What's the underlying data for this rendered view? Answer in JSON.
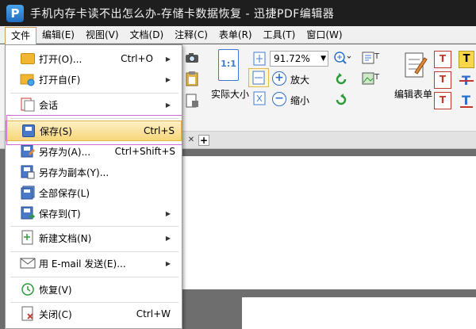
{
  "window": {
    "title": "手机内存卡读不出怎么办-存储卡数据恢复 - 迅捷PDF编辑器",
    "logo_letter": "P"
  },
  "menubar": {
    "items": [
      "文件",
      "编辑(E)",
      "视图(V)",
      "文档(D)",
      "注释(C)",
      "表单(R)",
      "工具(T)",
      "窗口(W)"
    ],
    "active_index": 0
  },
  "toolbar": {
    "actual_size_label": "实际大小",
    "fit_icon_text": "1:1",
    "zoom_value": "91.72%",
    "zoom_in_label": "放大",
    "zoom_out_label": "缩小",
    "edit_form_label": "编辑表单"
  },
  "file_menu": {
    "items": [
      {
        "label": "打开(O)...",
        "shortcut": "Ctrl+O",
        "icon": "folder-open-icon",
        "submenu": false
      },
      {
        "label": "打开自(F)",
        "shortcut": "",
        "icon": "folder-globe-icon",
        "submenu": true
      },
      {
        "label": "会话",
        "shortcut": "",
        "icon": "session-icon",
        "submenu": true
      },
      {
        "label": "保存(S)",
        "shortcut": "Ctrl+S",
        "icon": "save-icon",
        "submenu": false,
        "highlighted": true
      },
      {
        "label": "另存为(A)...",
        "shortcut": "Ctrl+Shift+S",
        "icon": "save-as-icon",
        "submenu": false
      },
      {
        "label": "另存为副本(Y)...",
        "shortcut": "",
        "icon": "save-copy-icon",
        "submenu": false
      },
      {
        "label": "全部保存(L)",
        "shortcut": "",
        "icon": "save-all-icon",
        "submenu": false
      },
      {
        "label": "保存到(T)",
        "shortcut": "",
        "icon": "save-to-icon",
        "submenu": true
      },
      {
        "label": "新建文档(N)",
        "shortcut": "",
        "icon": "new-document-icon",
        "submenu": true
      },
      {
        "label": "用 E-mail 发送(E)...",
        "shortcut": "",
        "icon": "email-icon",
        "submenu": true
      },
      {
        "label": "恢复(V)",
        "shortcut": "",
        "icon": "restore-icon",
        "submenu": false
      },
      {
        "label": "关闭(C)",
        "shortcut": "Ctrl+W",
        "icon": "close-document-icon",
        "submenu": false
      }
    ]
  },
  "colors": {
    "titlebar": "#1e1e1e",
    "highlight": "#f7d67a",
    "selection_outline": "#d26ad6",
    "doc_background": "#6e6e6e"
  }
}
